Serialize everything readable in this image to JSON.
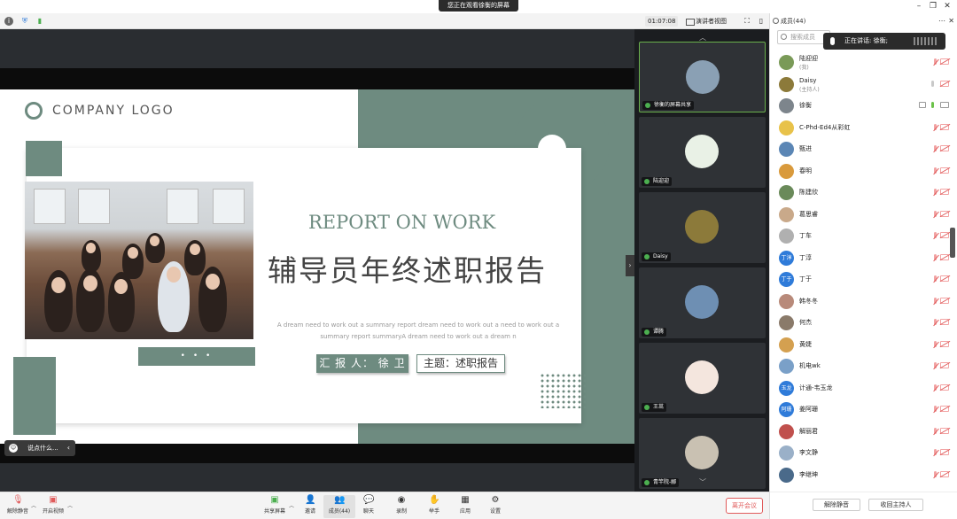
{
  "banner": {
    "text": "您正在观看徐衡的屏幕"
  },
  "toolbar": {
    "timer": "01:07:08",
    "view_mode": "演讲者视图"
  },
  "slide": {
    "logo_text": "COMPANY LOGO",
    "title_en": "REPORT ON WORK",
    "title_cn": "辅导员年终述职报告",
    "description": "A dream need to work out a summary report dream need to work out a need to work out a summary report summaryA dream need to work out a dream n",
    "reporter": "汇 报 人： 徐 卫",
    "theme": "主题：述职报告",
    "dots": "• • •"
  },
  "chat_input": {
    "placeholder": "说点什么..."
  },
  "video_tiles": [
    {
      "name": "徐衡的屏幕共享",
      "avatar_color": "#8aa0b4"
    },
    {
      "name": "陆迎迎",
      "avatar_color": "#e9f1e6"
    },
    {
      "name": "Daisy",
      "avatar_color": "#8c7a3a"
    },
    {
      "name": "谭腾",
      "avatar_color": "#6e8fb3"
    },
    {
      "name": "王茁",
      "avatar_color": "#f4e6de"
    },
    {
      "name": "青竿院-郦",
      "avatar_color": "#c9c1b2"
    }
  ],
  "panel": {
    "title": "成员(44)",
    "search_placeholder": "搜索成员",
    "speaking_label": "正在讲话: 徐衡;",
    "mute_all": "解除静音",
    "reclaim_host": "收回主持人"
  },
  "members": [
    {
      "name": "陆迎迎",
      "role": "(我)",
      "avatar_text": "",
      "avatar_color": "#7a9a58",
      "mic": "off",
      "cam": "off",
      "screen": false
    },
    {
      "name": "Daisy",
      "role": "(主持人)",
      "avatar_text": "",
      "avatar_color": "#8c7a3a",
      "mic": "on",
      "cam": "off",
      "screen": false
    },
    {
      "name": "徐衡",
      "role": "",
      "avatar_text": "",
      "avatar_color": "#7d858c",
      "mic": "live",
      "cam": "on",
      "screen": true
    },
    {
      "name": "C-Phd-Ed4从彩虹",
      "role": "",
      "avatar_text": "",
      "avatar_color": "#e8c24a",
      "mic": "off",
      "cam": "off",
      "screen": false
    },
    {
      "name": "甄进",
      "role": "",
      "avatar_text": "",
      "avatar_color": "#5b86b5",
      "mic": "off",
      "cam": "off",
      "screen": false
    },
    {
      "name": "春明",
      "role": "",
      "avatar_text": "",
      "avatar_color": "#d99a3c",
      "mic": "off",
      "cam": "off",
      "screen": false
    },
    {
      "name": "陈建欣",
      "role": "",
      "avatar_text": "",
      "avatar_color": "#6a8a5a",
      "mic": "off",
      "cam": "off",
      "screen": false
    },
    {
      "name": "葛思睿",
      "role": "",
      "avatar_text": "",
      "avatar_color": "#c9a98a",
      "mic": "off",
      "cam": "off",
      "screen": false
    },
    {
      "name": "丁车",
      "role": "",
      "avatar_text": "",
      "avatar_color": "#b0b0b0",
      "mic": "off",
      "cam": "off",
      "screen": false
    },
    {
      "name": "丁淳",
      "role": "",
      "avatar_text": "丁淳",
      "avatar_color": "#2f7bd9",
      "mic": "off",
      "cam": "off",
      "screen": false
    },
    {
      "name": "丁于",
      "role": "",
      "avatar_text": "丁于",
      "avatar_color": "#2f7bd9",
      "mic": "off",
      "cam": "off",
      "screen": false
    },
    {
      "name": "韩冬冬",
      "role": "",
      "avatar_text": "",
      "avatar_color": "#b88a7a",
      "mic": "off",
      "cam": "off",
      "screen": false
    },
    {
      "name": "何杰",
      "role": "",
      "avatar_text": "",
      "avatar_color": "#8a7a6a",
      "mic": "off",
      "cam": "off",
      "screen": false
    },
    {
      "name": "黄婕",
      "role": "",
      "avatar_text": "",
      "avatar_color": "#d4a050",
      "mic": "off",
      "cam": "off",
      "screen": false
    },
    {
      "name": "机电wk",
      "role": "",
      "avatar_text": "",
      "avatar_color": "#7aa0c8",
      "mic": "off",
      "cam": "off",
      "screen": false
    },
    {
      "name": "计通-韦玉龙",
      "role": "",
      "avatar_text": "玉龙",
      "avatar_color": "#2f7bd9",
      "mic": "off",
      "cam": "off",
      "screen": false
    },
    {
      "name": "姜阿珊",
      "role": "",
      "avatar_text": "阿珊",
      "avatar_color": "#2f7bd9",
      "mic": "off",
      "cam": "off",
      "screen": false
    },
    {
      "name": "解丽君",
      "role": "",
      "avatar_text": "",
      "avatar_color": "#c0504d",
      "mic": "off",
      "cam": "off",
      "screen": false
    },
    {
      "name": "李文静",
      "role": "",
      "avatar_text": "",
      "avatar_color": "#9ab0c8",
      "mic": "off",
      "cam": "off",
      "screen": false
    },
    {
      "name": "李继坤",
      "role": "",
      "avatar_text": "",
      "avatar_color": "#4a6a8a",
      "mic": "off",
      "cam": "off",
      "screen": false
    }
  ],
  "bottombar": {
    "unmute": "解除静音",
    "start_video": "开启视频",
    "share_screen": "共享屏幕",
    "invite": "邀请",
    "members": "成员(44)",
    "chat": "聊天",
    "record": "录制",
    "raise_hand": "举手",
    "apps": "应用",
    "settings": "设置",
    "leave": "离开会议"
  }
}
